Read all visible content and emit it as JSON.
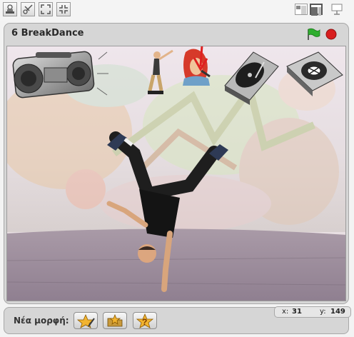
{
  "toolbar": {
    "tools": [
      "duplicate-tool",
      "delete-tool",
      "grow-tool",
      "shrink-tool"
    ],
    "view_modes": [
      "small-stage-mode",
      "normal-stage-mode",
      "presentation-mode"
    ]
  },
  "stage_header": {
    "title": "6 BreakDance",
    "green_flag_color": "#2fae2f",
    "stop_color": "#d81e1e"
  },
  "stage": {
    "sprites": [
      "boombox",
      "breakdancer-small",
      "singer-woman",
      "turntable-1",
      "turntable-2",
      "breakdancer-main"
    ],
    "arrow_color": "#e02020"
  },
  "sprite_bar": {
    "new_sprite_label": "Νέα μορφή:",
    "buttons": [
      "paint-new-sprite",
      "choose-sprite-from-file",
      "surprise-sprite"
    ]
  },
  "mouse": {
    "x_label": "x:",
    "x_value": "31",
    "y_label": "y:",
    "y_value": "149"
  }
}
